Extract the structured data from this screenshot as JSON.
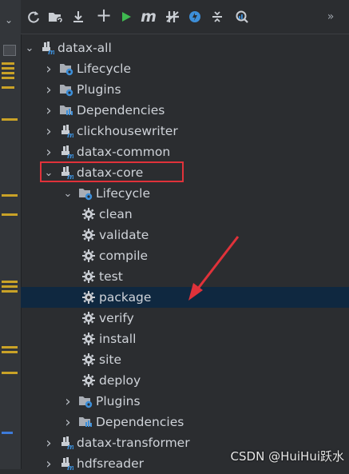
{
  "toolbar": {
    "buttons": [
      {
        "id": "reload",
        "icon": "reload-icon"
      },
      {
        "id": "generate",
        "icon": "generate-sources-icon"
      },
      {
        "id": "download",
        "icon": "download-icon"
      },
      {
        "id": "add",
        "icon": "plus-icon"
      },
      {
        "id": "run",
        "icon": "run-icon"
      },
      {
        "id": "maven",
        "icon": "maven-goal-icon",
        "label": "m"
      },
      {
        "id": "skip-tests",
        "icon": "toggle-skip-tests-icon"
      },
      {
        "id": "offline",
        "icon": "offline-icon"
      },
      {
        "id": "collapse",
        "icon": "collapse-icon"
      },
      {
        "id": "analyze",
        "icon": "analyze-dependencies-icon"
      },
      {
        "id": "more",
        "icon": "more-icon",
        "label": "»"
      }
    ]
  },
  "tree": [
    {
      "label": "datax-all",
      "type": "module",
      "expanded": true,
      "level": 0
    },
    {
      "label": "Lifecycle",
      "type": "lifecycle-folder",
      "expanded": false,
      "level": 1
    },
    {
      "label": "Plugins",
      "type": "plugins-folder",
      "expanded": false,
      "level": 1
    },
    {
      "label": "Dependencies",
      "type": "dependencies-folder",
      "expanded": false,
      "level": 1
    },
    {
      "label": "clickhousewriter",
      "type": "module",
      "expanded": false,
      "level": 1
    },
    {
      "label": "datax-common",
      "type": "module",
      "expanded": false,
      "level": 1
    },
    {
      "label": "datax-core",
      "type": "module",
      "expanded": true,
      "level": 1,
      "highlighted": true
    },
    {
      "label": "Lifecycle",
      "type": "lifecycle-folder",
      "expanded": true,
      "level": 2
    },
    {
      "label": "clean",
      "type": "goal",
      "level": 3
    },
    {
      "label": "validate",
      "type": "goal",
      "level": 3
    },
    {
      "label": "compile",
      "type": "goal",
      "level": 3
    },
    {
      "label": "test",
      "type": "goal",
      "level": 3
    },
    {
      "label": "package",
      "type": "goal",
      "level": 3,
      "selected": true
    },
    {
      "label": "verify",
      "type": "goal",
      "level": 3
    },
    {
      "label": "install",
      "type": "goal",
      "level": 3
    },
    {
      "label": "site",
      "type": "goal",
      "level": 3
    },
    {
      "label": "deploy",
      "type": "goal",
      "level": 3
    },
    {
      "label": "Plugins",
      "type": "plugins-folder",
      "expanded": false,
      "level": 2
    },
    {
      "label": "Dependencies",
      "type": "dependencies-folder",
      "expanded": false,
      "level": 2
    },
    {
      "label": "datax-transformer",
      "type": "module",
      "expanded": false,
      "level": 1
    },
    {
      "label": "hdfsreader",
      "type": "module",
      "expanded": false,
      "level": 1
    }
  ],
  "colors": {
    "background": "#2b2d30",
    "selection": "#0f2840",
    "annotation": "#e0323a",
    "run_green": "#3fb950",
    "folder_blue": "#3d8fd9"
  },
  "watermark": "CSDN @HuiHui跃水"
}
